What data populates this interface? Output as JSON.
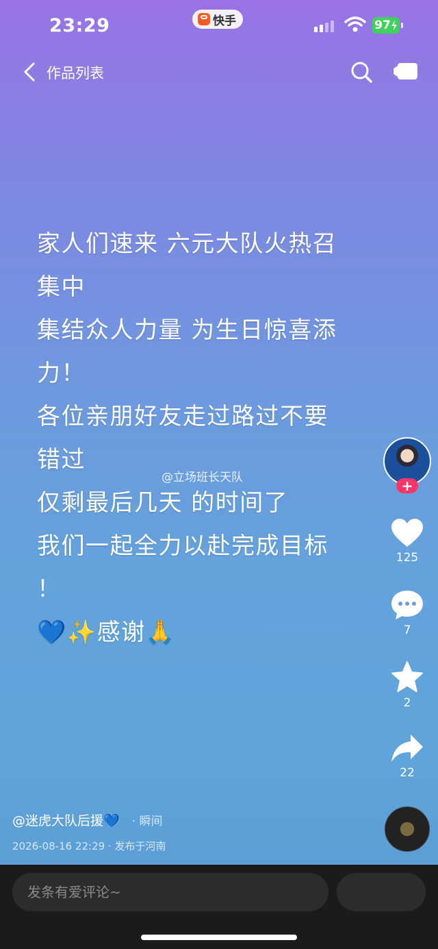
{
  "status_bar": {
    "time": "23:29",
    "app_name": "快手",
    "battery": "97",
    "accent_battery": "#3ed15d"
  },
  "nav": {
    "title": "作品列表",
    "back_icon": "chevron-left-icon",
    "search_icon": "search-icon",
    "cast_icon": "screen-cast-icon"
  },
  "post": {
    "text": "家人们速来 六元大队火热召\n集中\n集结众人力量 为生日惊喜添\n力！\n各位亲朋好友走过路过不要\n错过\n仅剩最后几天 的时间了\n我们一起全力以赴完成目标\n！\n💙✨感谢🙏"
  },
  "watermark": "@立场班长天队",
  "side_rail": {
    "follow_plus": "+",
    "like_count": "125",
    "comment_count": "7",
    "favorite_count": "2",
    "share_count": "22",
    "like_icon": "heart-icon",
    "comment_icon": "comment-icon",
    "favorite_icon": "star-icon",
    "share_icon": "share-icon",
    "accent_follow": "#fe3666"
  },
  "author": {
    "handle": "@迷虎大队后援💙",
    "moment": "· 瞬间",
    "date_location": "2026-08-16 22:29 · 发布于河南"
  },
  "comment_bar": {
    "placeholder": "发条有爱评论~"
  }
}
